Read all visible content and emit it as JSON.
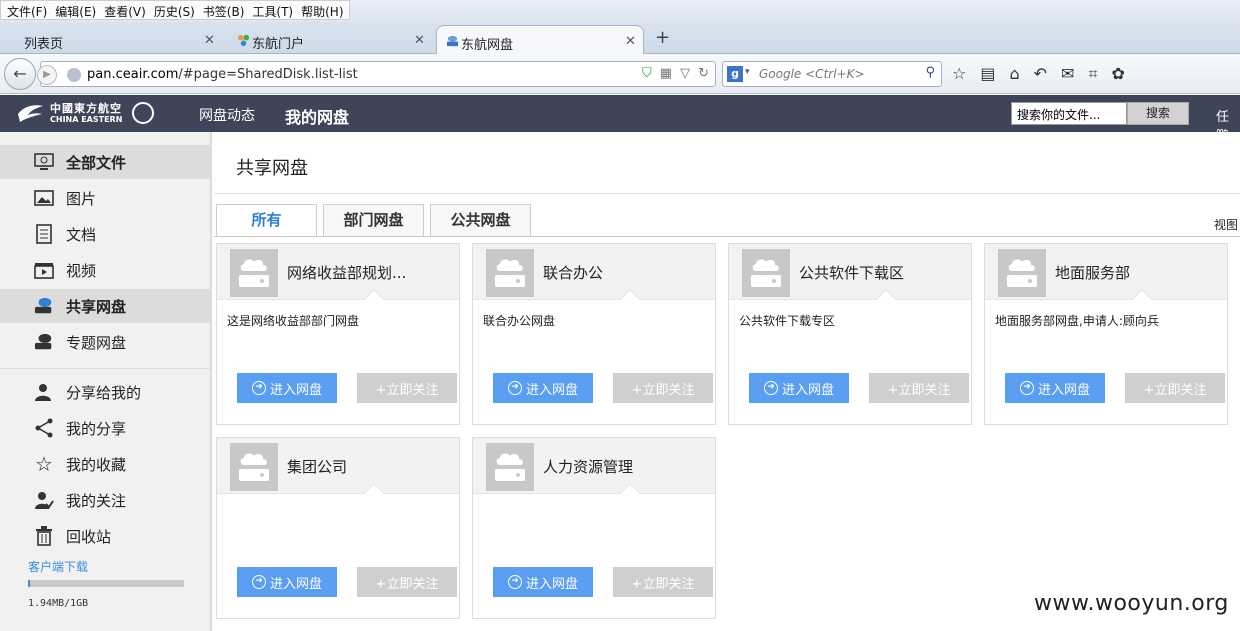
{
  "browser": {
    "menu": [
      "文件(F)",
      "编辑(E)",
      "查看(V)",
      "历史(S)",
      "书签(B)",
      "工具(T)",
      "帮助(H)"
    ],
    "tabs": [
      {
        "label": "列表页",
        "active": false
      },
      {
        "label": "东航门户",
        "active": false
      },
      {
        "label": "东航网盘",
        "active": true
      }
    ],
    "new_tab": "+",
    "address": {
      "host": "pan.ceair.com",
      "path": "/#page=SharedDisk.list-list"
    },
    "search_placeholder": "Google <Ctrl+K>"
  },
  "header": {
    "logo_cn": "中國東方航空",
    "logo_en": "CHINA EASTERN",
    "nav": [
      {
        "label": "网盘动态",
        "current": false
      },
      {
        "label": "我的网盘",
        "current": true
      }
    ],
    "file_search_value": "搜索你的文件...",
    "search_button": "搜索",
    "username": "任鹏"
  },
  "sidebar": {
    "items": [
      {
        "label": "全部文件",
        "icon": "monitor-icon"
      },
      {
        "label": "图片",
        "icon": "image-icon"
      },
      {
        "label": "文档",
        "icon": "document-icon"
      },
      {
        "label": "视频",
        "icon": "video-icon"
      },
      {
        "label": "共享网盘",
        "icon": "shared-disk-icon"
      },
      {
        "label": "专题网盘",
        "icon": "topic-disk-icon"
      },
      {
        "label": "分享给我的",
        "icon": "shared-with-me-icon"
      },
      {
        "label": "我的分享",
        "icon": "share-icon"
      },
      {
        "label": "我的收藏",
        "icon": "star-icon"
      },
      {
        "label": "我的关注",
        "icon": "follow-icon"
      },
      {
        "label": "回收站",
        "icon": "trash-icon"
      }
    ],
    "client_download": "客户端下载",
    "quota_used_fraction": 0.002,
    "quota_text": "1.94MB/1GB"
  },
  "main": {
    "title": "共享网盘",
    "tabs": [
      {
        "label": "所有",
        "active": true
      },
      {
        "label": "部门网盘",
        "active": false
      },
      {
        "label": "公共网盘",
        "active": false
      }
    ],
    "view_label": "视图",
    "enter_label": "进入网盘",
    "follow_label": "+立即关注",
    "disks": [
      {
        "name": "网络收益部规划...",
        "desc": "这是网络收益部部门网盘"
      },
      {
        "name": "联合办公",
        "desc": "联合办公网盘"
      },
      {
        "name": "公共软件下载区",
        "desc": "公共软件下载专区"
      },
      {
        "name": "地面服务部",
        "desc": "地面服务部网盘,申请人:顾向兵"
      },
      {
        "name": "集团公司",
        "desc": ""
      },
      {
        "name": "人力资源管理",
        "desc": ""
      }
    ]
  },
  "watermark": "www.wooyun.org",
  "colors": {
    "header_bg": "#3f4559",
    "accent": "#3d8eef",
    "sidebar_bg": "#f1f1f1"
  }
}
